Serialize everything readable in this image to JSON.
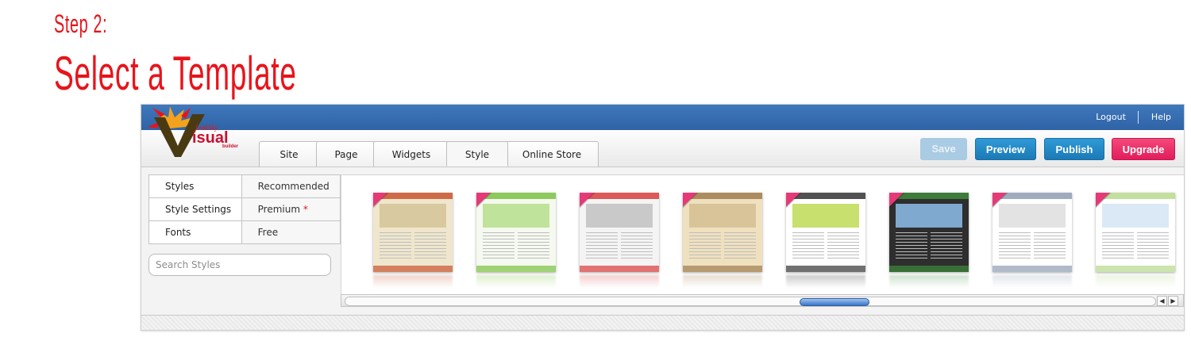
{
  "heading": {
    "step": "Step 2:",
    "title": "Select a Template"
  },
  "app": {
    "logo": {
      "small": "LinkSky",
      "main": "isual",
      "sub": "builder"
    },
    "topbar": {
      "logout": "Logout",
      "help": "Help"
    },
    "tabs": [
      {
        "label": "Site"
      },
      {
        "label": "Page"
      },
      {
        "label": "Widgets"
      },
      {
        "label": "Style"
      },
      {
        "label": "Online Store"
      }
    ],
    "actions": {
      "save": "Save",
      "preview": "Preview",
      "publish": "Publish",
      "upgrade": "Upgrade"
    },
    "sidebar": {
      "rows": [
        {
          "left": "Styles",
          "right": "Recommended"
        },
        {
          "left": "Style Settings",
          "right": "Premium",
          "marker": "*"
        },
        {
          "left": "Fonts",
          "right": "Free"
        }
      ],
      "search_placeholder": "Search Styles"
    },
    "templates": {
      "ribbon": "***",
      "items": [
        {
          "name": "restaurant-template",
          "colors": [
            "#efe6cc",
            "#c9542f",
            "#d9c9a0"
          ]
        },
        {
          "name": "green-nature-template",
          "colors": [
            "#f5f9ef",
            "#7bc142",
            "#bfe39a"
          ]
        },
        {
          "name": "gift-template",
          "colors": [
            "#f4f4f4",
            "#d83c3c",
            "#c9c9c9"
          ]
        },
        {
          "name": "safari-template",
          "colors": [
            "#efe0be",
            "#a07c4f",
            "#d9c49a"
          ]
        },
        {
          "name": "video-template",
          "colors": [
            "#ffffff",
            "#333333",
            "#c7e06e"
          ]
        },
        {
          "name": "dark-forest-template",
          "colors": [
            "#2e2e2e",
            "#3f8a3c",
            "#7fa9cf"
          ]
        },
        {
          "name": "business-people-template",
          "colors": [
            "#ffffff",
            "#8e9db3",
            "#e3e3e3"
          ]
        },
        {
          "name": "sky-template",
          "colors": [
            "#ffffff",
            "#b7d98c",
            "#dbe9f6"
          ]
        }
      ]
    }
  }
}
